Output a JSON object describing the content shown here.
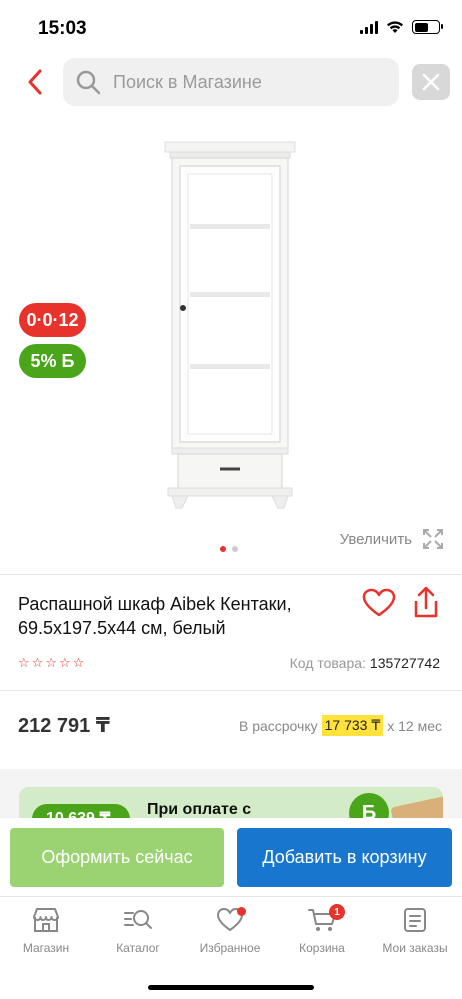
{
  "status": {
    "time": "15:03"
  },
  "search": {
    "placeholder": "Поиск в Магазине"
  },
  "badges": {
    "installment": "0·0·12",
    "bonus": "5% Б"
  },
  "gallery": {
    "zoom_label": "Увеличить",
    "slides": 2,
    "active_slide": 1
  },
  "product": {
    "title": "Распашной шкаф Aibek Кентаки, 69.5x197.5x44 см, белый",
    "rating_stars": 5,
    "rating_value": 0,
    "sku_label": "Код товара:",
    "sku": "135727742",
    "price": "212 791 ₸",
    "installment_prefix": "В рассрочку",
    "installment_amount": "17 733 ₸",
    "installment_suffix": "х 12 мес"
  },
  "promo": {
    "amount": "10 639 ₸",
    "text": "При оплате с",
    "badge": "Б"
  },
  "actions": {
    "buy_now": "Оформить сейчас",
    "add_to_cart": "Добавить в корзину"
  },
  "tabs": [
    {
      "label": "Магазин",
      "icon": "store-icon"
    },
    {
      "label": "Каталог",
      "icon": "catalog-search-icon"
    },
    {
      "label": "Избранное",
      "icon": "heart-icon",
      "dot": true
    },
    {
      "label": "Корзина",
      "icon": "cart-icon",
      "badge": "1"
    },
    {
      "label": "Мои заказы",
      "icon": "orders-icon"
    }
  ],
  "colors": {
    "accent_red": "#e8322c",
    "green": "#4aa51a",
    "blue": "#1976cf",
    "light_green": "#9bd372"
  }
}
